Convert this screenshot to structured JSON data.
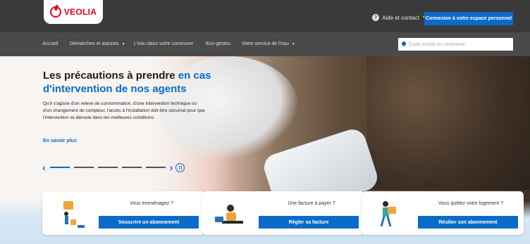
{
  "header": {
    "logo_text": "VEOLIA",
    "help_label": "Aide et contact",
    "connect_label": "Connexion à votre espace personnel"
  },
  "nav": {
    "items": [
      {
        "label": "Accueil",
        "dropdown": false
      },
      {
        "label": "Démarches et astuces",
        "dropdown": true
      },
      {
        "label": "L'eau dans votre commune",
        "dropdown": false
      },
      {
        "label": "Eco-gestes",
        "dropdown": false
      },
      {
        "label": "Votre service de l'eau",
        "dropdown": true
      }
    ],
    "search_placeholder": "Code postal ou commune"
  },
  "hero": {
    "title_plain": "Les précautions à prendre ",
    "title_accent": "en cas d'intervention de nos agents",
    "text": "Qu'il s'agisse d'un relevé de consommation, d'une intervention technique ou d'un changement de compteur, l'accès à l'installation doit être sécurisé pour que l'intervention se déroule dans les meilleures conditions.",
    "link": "En savoir plus"
  },
  "carousel": {
    "prev": "‹",
    "next": "›",
    "slides": 5,
    "active_slide": 1
  },
  "cards": [
    {
      "title": "Vous emménagez ?",
      "button": "Souscrire un abonnement"
    },
    {
      "title": "Une facture à payer ?",
      "button": "Régler sa facture"
    },
    {
      "title": "Vous quittez votre logement ?",
      "button": "Résilier son abonnement"
    }
  ],
  "colors": {
    "brand_red": "#e2001a",
    "accent_blue": "#0a6cc7",
    "topbar": "#3a3a3a",
    "navbar": "#4a4a4a"
  }
}
